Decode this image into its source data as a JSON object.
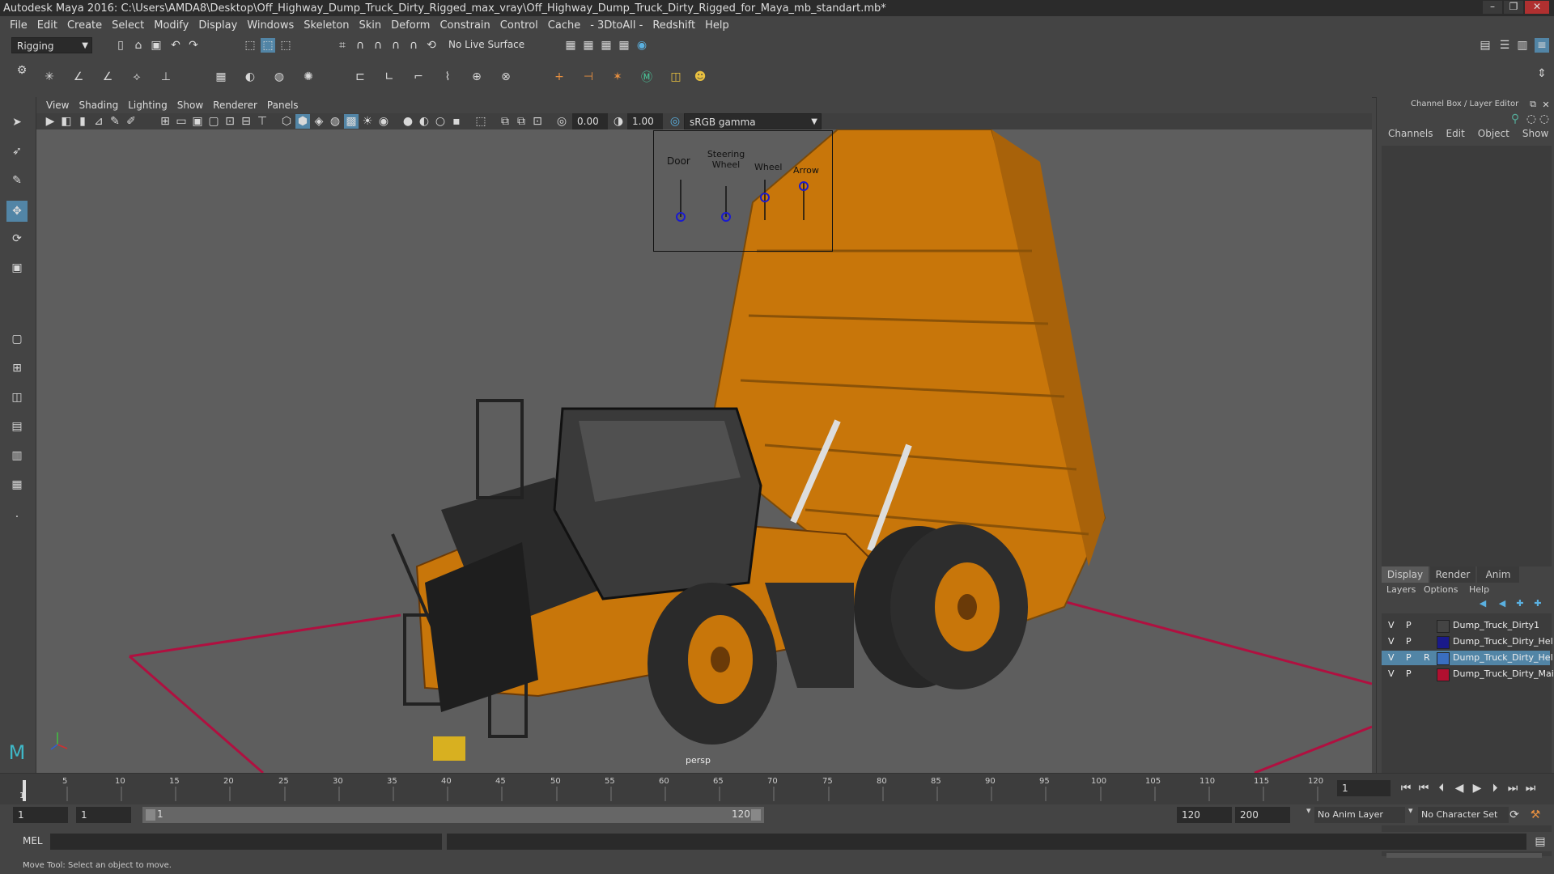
{
  "window": {
    "title": "Autodesk Maya 2016: C:\\Users\\AMDA8\\Desktop\\Off_Highway_Dump_Truck_Dirty_Rigged_max_vray\\Off_Highway_Dump_Truck_Dirty_Rigged_for_Maya_mb_standart.mb*",
    "buttons": [
      "–",
      "❐",
      "✕"
    ]
  },
  "menubar": [
    "File",
    "Edit",
    "Create",
    "Select",
    "Modify",
    "Display",
    "Windows",
    "Skeleton",
    "Skin",
    "Deform",
    "Constrain",
    "Control",
    "Cache",
    "- 3DtoAll -",
    "Redshift",
    "Help"
  ],
  "statusline": {
    "mode": "Rigging",
    "live_surface": "No Live Surface"
  },
  "viewport": {
    "menu": [
      "View",
      "Shading",
      "Lighting",
      "Show",
      "Renderer",
      "Panels"
    ],
    "exposure": "0.00",
    "gamma": "1.00",
    "color_space": "sRGB gamma",
    "camera_label": "persp",
    "control_panel": {
      "labels": [
        "Door",
        "Steering Wheel",
        "Wheel",
        "Arrow"
      ]
    }
  },
  "channel_box": {
    "title": "Channel Box / Layer Editor",
    "menu": [
      "Channels",
      "Edit",
      "Object",
      "Show"
    ],
    "layer_tabs": [
      "Display",
      "Render",
      "Anim"
    ],
    "layer_menu": [
      "Layers",
      "Options",
      "Help"
    ],
    "layers": [
      {
        "v": "V",
        "p": "P",
        "r": "",
        "name": "Dump_Truck_Dirty1",
        "color": "#444444"
      },
      {
        "v": "V",
        "p": "P",
        "r": "",
        "name": "Dump_Truck_Dirty_Hel",
        "color": "#1a1a8a"
      },
      {
        "v": "V",
        "p": "P",
        "r": "R",
        "name": "Dump_Truck_Dirty_Hel",
        "color": "#3a6ec0"
      },
      {
        "v": "V",
        "p": "P",
        "r": "",
        "name": "Dump_Truck_Dirty_Mai",
        "color": "#b01030"
      }
    ]
  },
  "timeline": {
    "ticks": [
      "5",
      "10",
      "15",
      "20",
      "25",
      "30",
      "35",
      "40",
      "45",
      "50",
      "55",
      "60",
      "65",
      "70",
      "75",
      "80",
      "85",
      "90",
      "95",
      "100",
      "105",
      "110",
      "115",
      "120"
    ],
    "start_label": "1",
    "current_frame": "1"
  },
  "range": {
    "start": "1",
    "anim_start": "1",
    "slider_start": "1",
    "slider_end": "120",
    "end": "120",
    "anim_end": "200",
    "anim_layer": "No Anim Layer",
    "character_set": "No Character Set"
  },
  "cmdline": {
    "label": "MEL"
  },
  "helpline": {
    "text": "Move Tool: Select an object to move."
  }
}
